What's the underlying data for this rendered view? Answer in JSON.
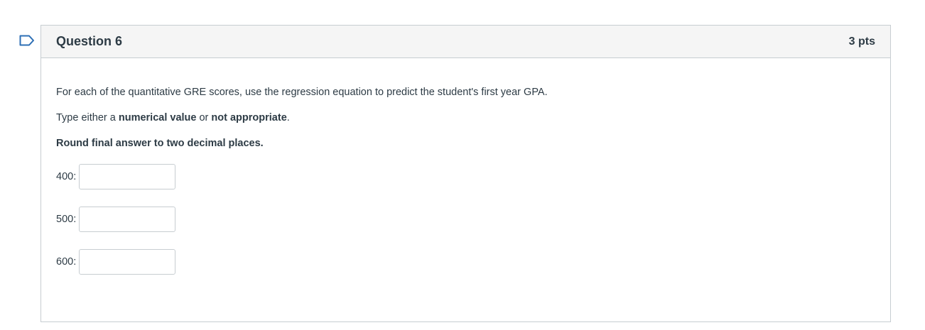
{
  "question": {
    "title": "Question 6",
    "points": "3 pts",
    "prompt": "For each of the quantitative GRE scores, use the regression equation to predict the student's first year GPA.",
    "instruction": {
      "prefix": "Type either a ",
      "option1": "numerical value",
      "middle": " or ",
      "option2": "not appropriate",
      "suffix": "."
    },
    "rounding_note": "Round final answer to two decimal places.",
    "answers": [
      {
        "label": "400:",
        "value": ""
      },
      {
        "label": "500:",
        "value": ""
      },
      {
        "label": "600:",
        "value": ""
      }
    ]
  },
  "colors": {
    "border": "#c7cdd1",
    "header_bg": "#f5f5f5",
    "text": "#2d3b45"
  }
}
